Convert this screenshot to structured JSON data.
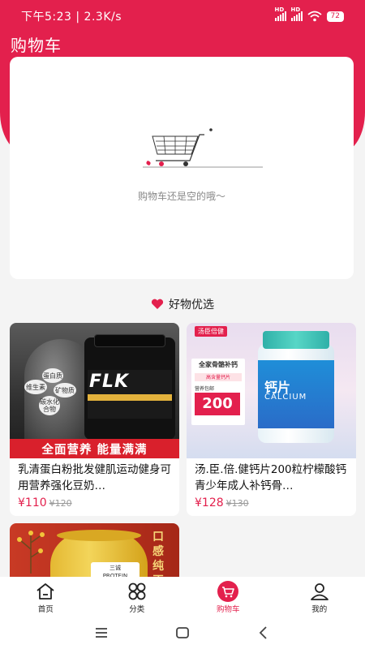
{
  "status_bar": {
    "time_speed": "下午5:23 | 2.3K/s",
    "signal_1": "HD",
    "signal_2": "HD",
    "battery": "72"
  },
  "header": {
    "title": "购物车"
  },
  "empty_cart": {
    "message": "购物车还是空的哦～"
  },
  "recommend": {
    "title": "好物优选",
    "products": [
      {
        "name": "乳清蛋白粉批发健肌运动健身可用营养强化豆奶…",
        "price": "¥110",
        "original_price": "¥120",
        "image": {
          "brand": "FLK",
          "banner": "全面营养 能量满满",
          "bubbles": [
            "蛋白质",
            "维生素",
            "矿物质",
            "碳水化合物"
          ]
        }
      },
      {
        "name": "汤.臣.倍.健钙片200粒柠檬酸钙青少年成人补钙骨…",
        "price": "¥128",
        "original_price": "¥130",
        "image": {
          "brand": "汤臣倍健",
          "panel_title": "全家骨骼补钙",
          "panel_sub": "高含量钙片",
          "panel_free": "营养包邮",
          "count": "200",
          "bottle_zh": "钙片",
          "bottle_en": "CALCIUM"
        }
      },
      {
        "image": {
          "brand": "三诚",
          "label": "PROTEIN",
          "side_text": "口感纯正"
        }
      }
    ]
  },
  "tabs": [
    {
      "label": "首页",
      "icon": "home-icon",
      "active": false
    },
    {
      "label": "分类",
      "icon": "category-icon",
      "active": false
    },
    {
      "label": "购物车",
      "icon": "cart-icon",
      "active": true
    },
    {
      "label": "我的",
      "icon": "profile-icon",
      "active": false
    }
  ],
  "colors": {
    "accent": "#e3204d",
    "background": "#f4f4f4"
  }
}
